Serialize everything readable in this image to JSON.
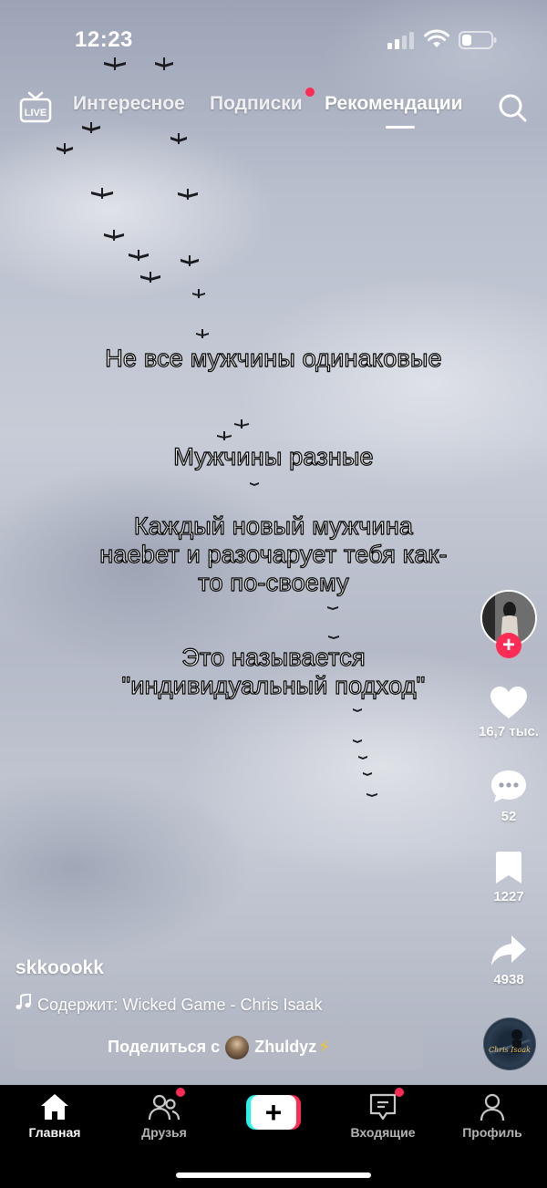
{
  "status_bar": {
    "time": "12:23"
  },
  "top_nav": {
    "live_label": "LIVE",
    "tabs": [
      {
        "label": "Интересное",
        "active": false
      },
      {
        "label": "Подписки",
        "active": false,
        "has_dot": true
      },
      {
        "label": "Рекомендации",
        "active": true
      }
    ]
  },
  "video": {
    "overlay_text": [
      "Не все мужчины одинаковые",
      "Мужчины разные",
      "Каждый новый мужчина наеbет и разочарует тебя как-то по-своему",
      "Это называется \"индивидуальный подход\""
    ],
    "username": "skkoookk",
    "music": "Содержит: Wicked Game - Chris Isaak"
  },
  "actions": {
    "likes": "16,7 тыс.",
    "comments": "52",
    "saves": "1227",
    "shares": "4938"
  },
  "music_disc": {
    "label": "Chris Isaak"
  },
  "share_bar": {
    "prefix": "Поделиться с",
    "name": "Zhuldyz",
    "emoji": "⚡"
  },
  "bottom_nav": {
    "items": [
      {
        "label": "Главная",
        "icon": "home-icon",
        "active": true
      },
      {
        "label": "Друзья",
        "icon": "friends-icon",
        "has_dot": true
      },
      {
        "label": "",
        "icon": "create-icon"
      },
      {
        "label": "Входящие",
        "icon": "inbox-icon",
        "has_dot": true
      },
      {
        "label": "Профиль",
        "icon": "profile-icon"
      }
    ]
  },
  "colors": {
    "accent_red": "#fe2c55",
    "accent_cyan": "#25f4ee"
  }
}
